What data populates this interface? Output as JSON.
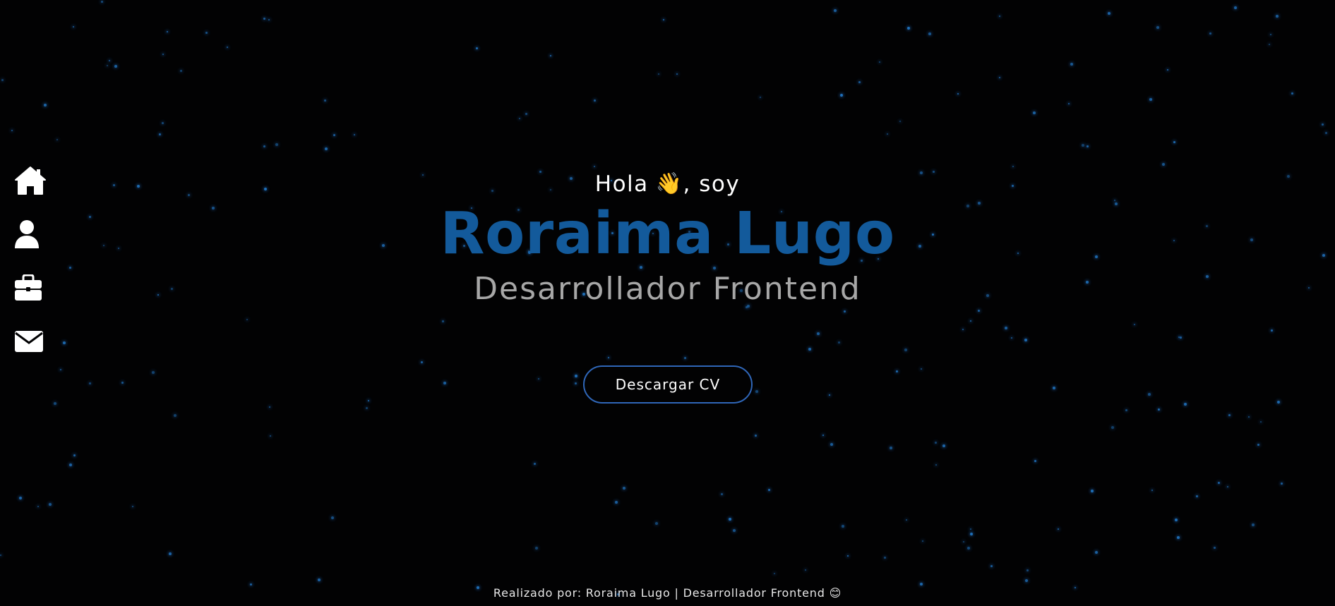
{
  "nav": {
    "items": [
      {
        "icon": "home-icon",
        "label": "home"
      },
      {
        "icon": "user-icon",
        "label": "about"
      },
      {
        "icon": "briefcase-icon",
        "label": "portfolio"
      },
      {
        "icon": "envelope-icon",
        "label": "contact"
      }
    ]
  },
  "hero": {
    "greeting_before": "Hola",
    "greeting_emoji": "👋",
    "greeting_after": ", soy",
    "name": "Roraima Lugo",
    "role": "Desarrollador Frontend",
    "cv_button": "Descargar CV"
  },
  "footer": {
    "text": "Realizado por: Roraima Lugo | Desarrollador Frontend 😊"
  },
  "colors": {
    "background": "#020203",
    "name": "#135a9b",
    "role": "#a7a7a7",
    "star": "#1f6fb8",
    "button_border": "#2f66b8"
  }
}
